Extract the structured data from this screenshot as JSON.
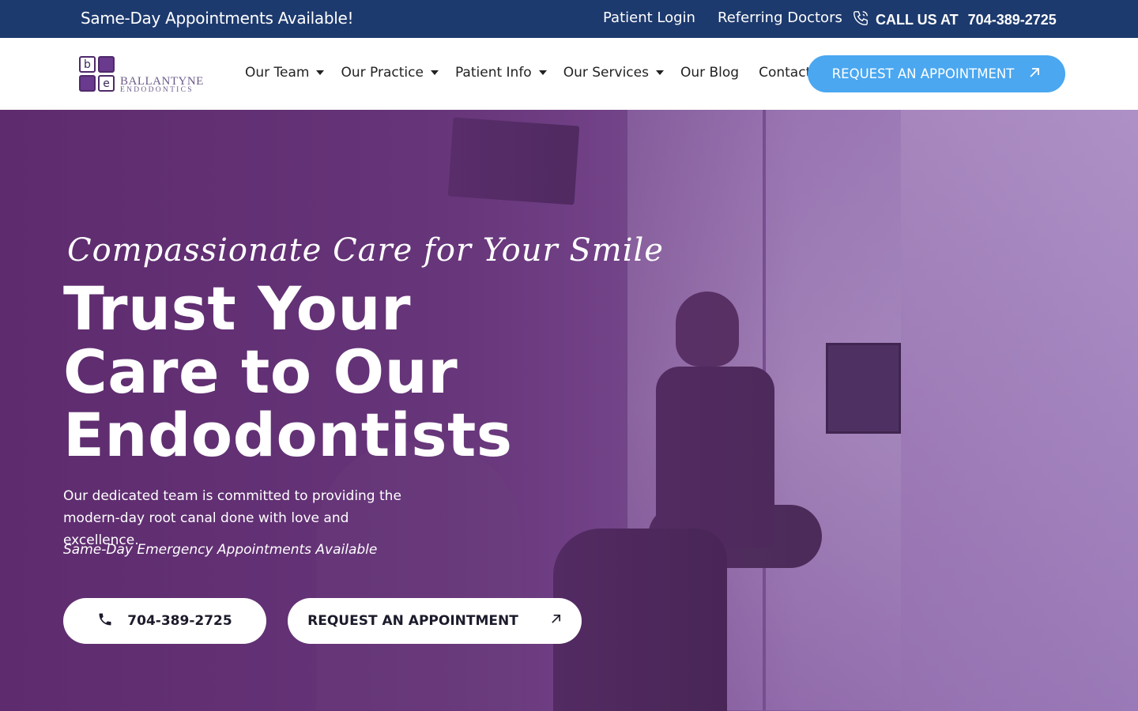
{
  "topbar": {
    "promo": "Same-Day Appointments Available!",
    "patient_login": "Patient Login",
    "referring_doctors": "Referring Doctors",
    "call_label": "CALL US AT",
    "phone": "704-389-2725"
  },
  "logo": {
    "tiles": [
      "b",
      "",
      "",
      "e"
    ],
    "name_line1": "BALLANTYNE",
    "name_line2": "ENDODONTICS"
  },
  "nav": {
    "items": [
      {
        "label": "Our Team",
        "dropdown": true
      },
      {
        "label": "Our Practice",
        "dropdown": true
      },
      {
        "label": "Patient Info",
        "dropdown": true
      },
      {
        "label": "Our Services",
        "dropdown": true
      },
      {
        "label": "Our Blog",
        "dropdown": false
      },
      {
        "label": "Contact",
        "dropdown": false
      }
    ],
    "cta": "REQUEST AN APPOINTMENT"
  },
  "hero": {
    "tagline": "Compassionate Care for Your Smile",
    "headline_lines": [
      "Trust Your",
      "Care to Our",
      "Endodontists"
    ],
    "description": "Our dedicated team is committed to providing the modern-day root canal done with love and excellence.",
    "emergency": "Same-Day Emergency Appointments Available",
    "phone_button": "704-389-2725",
    "appointment_button": "REQUEST AN APPOINTMENT"
  },
  "colors": {
    "topbar_bg": "#1d3a6e",
    "cta_blue": "#4aa7f0",
    "hero_purple": "#5f2e70"
  },
  "icons": {
    "phone": "phone-icon",
    "arrow": "arrow-up-right-icon",
    "caret": "caret-down-icon"
  }
}
